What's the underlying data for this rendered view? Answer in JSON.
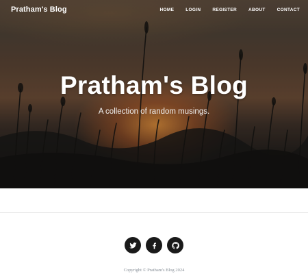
{
  "navbar": {
    "brand": "Pratham's Blog",
    "links": [
      "HOME",
      "LOGIN",
      "REGISTER",
      "ABOUT",
      "CONTACT"
    ]
  },
  "hero": {
    "title": "Pratham's Blog",
    "subtitle": "A collection of random musings."
  },
  "footer": {
    "social_icons": [
      "twitter-icon",
      "facebook-icon",
      "github-icon"
    ],
    "copyright": "Copyright © Pratham's Blog 2024"
  },
  "colors": {
    "social_button_bg": "#1a1a1a",
    "nav_text": "#ffffff",
    "copyright_text": "#868e96"
  }
}
